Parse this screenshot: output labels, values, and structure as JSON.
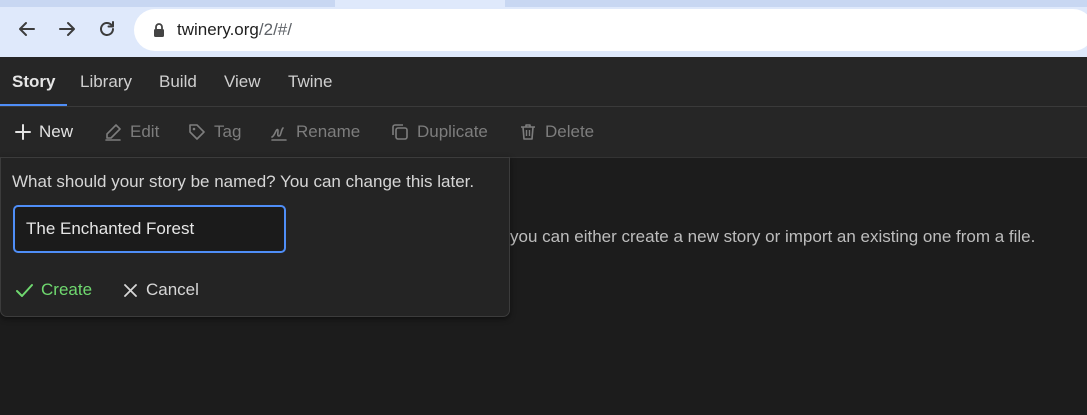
{
  "browser": {
    "url_host": "twinery.org",
    "url_path": "/2/#/"
  },
  "top_tabs": [
    {
      "label": "Story"
    },
    {
      "label": "Library"
    },
    {
      "label": "Build"
    },
    {
      "label": "View"
    },
    {
      "label": "Twine"
    }
  ],
  "toolbar": {
    "new_label": "New",
    "edit_label": "Edit",
    "tag_label": "Tag",
    "rename_label": "Rename",
    "duplicate_label": "Duplicate",
    "delete_label": "Delete"
  },
  "main": {
    "empty_message": "you can either create a new story or import an existing one from a file."
  },
  "dialog": {
    "prompt": "What should your story be named? You can change this later.",
    "input_value": "The Enchanted Forest",
    "create_label": "Create",
    "cancel_label": "Cancel"
  },
  "colors": {
    "accent": "#4f8ef7",
    "create_green": "#6fd86f",
    "background": "#1c1c1c"
  }
}
